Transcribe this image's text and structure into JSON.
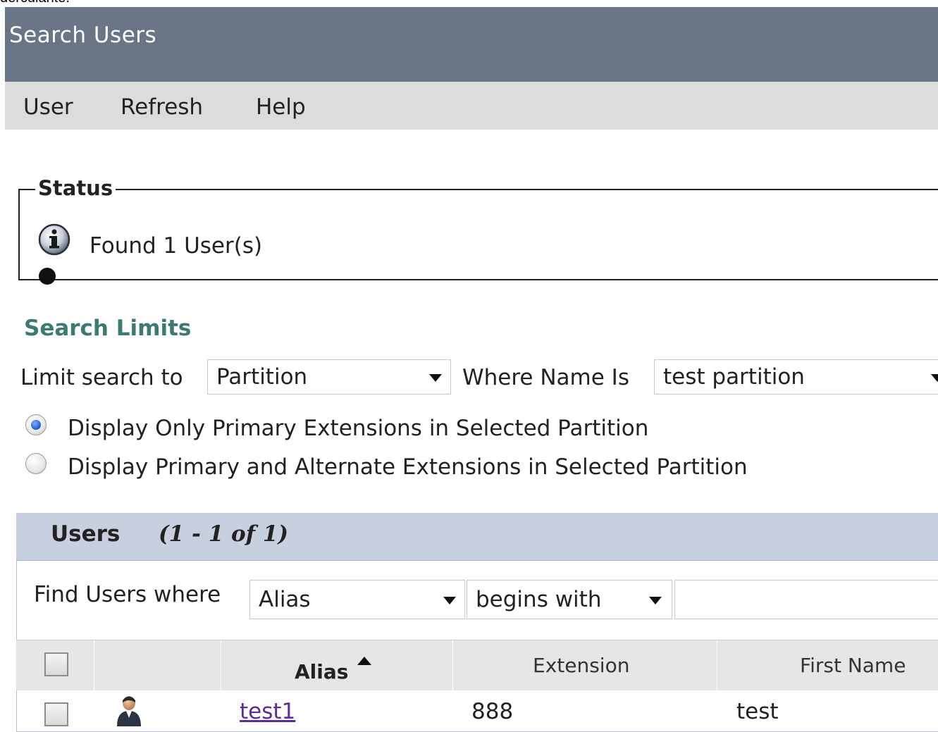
{
  "top_clip": {
    "text": "derculante."
  },
  "header": {
    "title": "Search Users"
  },
  "menu": [
    {
      "label": "User"
    },
    {
      "label": "Refresh"
    },
    {
      "label": "Help"
    }
  ],
  "status": {
    "legend": "Status",
    "message": "Found 1 User(s)",
    "icon": "info-icon"
  },
  "search_limits": {
    "title": "Search Limits",
    "limit_label": "Limit search to",
    "limit_value": "Partition",
    "where_label": "Where Name Is",
    "where_value": "test partition",
    "radio_options": [
      {
        "label": "Display Only Primary Extensions in Selected Partition",
        "selected": true
      },
      {
        "label": "Display Primary and Alternate Extensions in Selected Partition",
        "selected": false
      }
    ]
  },
  "users": {
    "title": "Users",
    "range": "(1 - 1 of 1)",
    "find_label": "Find Users where",
    "field_value": "Alias",
    "operator_value": "begins with",
    "search_value": "",
    "columns": [
      "Alias",
      "Extension",
      "First Name"
    ],
    "sort_column": "Alias",
    "rows": [
      {
        "alias": "test1",
        "extension": "888",
        "first_name": "test",
        "icon": "user-icon"
      }
    ]
  },
  "colors": {
    "title_bar": "#6b7588",
    "menu_bar": "#dcdcdc",
    "section_title": "#3c7a72",
    "users_header": "#c8d0e0",
    "link": "#5a2c9e"
  }
}
